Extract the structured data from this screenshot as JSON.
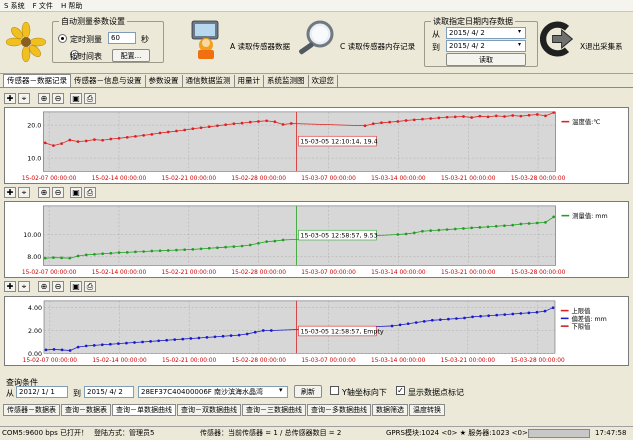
{
  "menu": [
    "S 系统",
    "F 文件",
    "H 帮助"
  ],
  "auto_measure": {
    "title": "自动测量参数设置",
    "timed_label": "定时测量",
    "interval_value": "60",
    "interval_unit": "秒",
    "by_time_label": "按时间表",
    "config_btn": "配置..."
  },
  "toolbar": {
    "read_sensor": "A 读取传感器数据",
    "read_memory": "C 读取传感器内存记录",
    "exit": "X退出采集系"
  },
  "mem_read": {
    "title": "读取指定日期内存数据",
    "from_label": "从",
    "from_date": "2015/ 4/ 2",
    "to_label": "到",
    "to_date": "2015/ 4/ 2",
    "read_btn": "读取"
  },
  "tabs": [
    "传感器－数据记录",
    "传感器－信息与设置",
    "参数设置",
    "通信数据监测",
    "用量计",
    "系统监测图",
    "欢迎您"
  ],
  "query": {
    "title": "查询条件",
    "from_label": "从",
    "from_date": "2012/ 1/ 1",
    "to_label": "到",
    "to_date": "2015/ 4/ 2",
    "sensor": "28EF37C40400006F  南沙滨海水晶湾",
    "refresh": "刷新",
    "y_down_label": "Y轴坐标向下",
    "show_points_label": "显示数据点标记"
  },
  "bottom_tabs": [
    "传感器－数据表",
    "查询－数据表",
    "查询－单数据曲线",
    "查询－双数据曲线",
    "查询－三数据曲线",
    "查询－多数据曲线",
    "数据筛选",
    "温度转换"
  ],
  "status": {
    "port": "COM5:9600 bps 已打开！",
    "login": "登陆方式：管理员5",
    "sensor_info": "传感器：当前传感器 = 1 / 总传感器数目 = 2",
    "gprs": "GPRS模块:1024 <0> ★ 服务器:1023 <0>",
    "time": "17:47:58"
  },
  "colors": {
    "temp": "#e02020",
    "measure": "#20a020",
    "upper": "#e02020",
    "bias": "#1a1acc",
    "lower": "#cc2020",
    "cursor1": "#d82020",
    "cursor2": "#20a020",
    "cursor3": "#d82020"
  },
  "chart_data": [
    {
      "type": "line",
      "x_ticks": [
        "15-02-07 00:00:00",
        "15-02-14 00:00:00",
        "15-02-21 00:00:00",
        "15-02-28 00:00:00",
        "15-03-07 00:00:00",
        "15-03-14 00:00:00",
        "15-03-21 00:00:00",
        "15-03-28 00:00:00"
      ],
      "y_ticks": [
        "10.0",
        "20.0"
      ],
      "ylim": [
        6,
        24
      ],
      "series": [
        {
          "name": "温度值:℃",
          "values": [
            14.6,
            13.8,
            14.4,
            15.5,
            15.0,
            15.2,
            15.6,
            15.4,
            15.8,
            16.0,
            16.3,
            16.6,
            16.9,
            17.2,
            17.6,
            17.9,
            18.2,
            18.5,
            18.9,
            19.2,
            19.5,
            19.8,
            20.1,
            20.4,
            20.6,
            20.9,
            21.1,
            21.3,
            21.0,
            20.2,
            20.5,
            null,
            null,
            null,
            null,
            null,
            null,
            null,
            null,
            19.8,
            20.4,
            20.7,
            20.9,
            21.1,
            21.4,
            21.6,
            21.8,
            22.0,
            22.2,
            22.4,
            22.5,
            22.6,
            22.3,
            22.7,
            22.5,
            22.8,
            22.6,
            22.9,
            22.7,
            23.0,
            23.2,
            22.8,
            23.8
          ]
        }
      ],
      "cursor_label": "15-03-05 12:10:14, 19.4"
    },
    {
      "type": "line",
      "x_ticks": [
        "15-02-07 00:00:00",
        "15-02-14 00:00:00",
        "15-02-21 00:00:00",
        "15-02-28 00:00:00",
        "15-03-07 00:00:00",
        "15-03-14 00:00:00",
        "15-03-21 00:00:00",
        "15-03-28 00:00:00"
      ],
      "y_ticks": [
        "8.00",
        "10.00"
      ],
      "ylim": [
        7.2,
        12.6
      ],
      "series": [
        {
          "name": "测量值: mm",
          "values": [
            7.85,
            7.9,
            7.88,
            7.85,
            8.05,
            8.15,
            8.2,
            8.25,
            8.3,
            8.35,
            8.38,
            8.42,
            8.45,
            8.5,
            8.52,
            8.55,
            8.58,
            8.62,
            8.65,
            8.7,
            8.75,
            8.8,
            8.85,
            8.9,
            8.95,
            9.05,
            9.2,
            9.35,
            9.4,
            9.5,
            null,
            null,
            null,
            null,
            null,
            null,
            null,
            null,
            null,
            null,
            null,
            null,
            null,
            10.0,
            10.05,
            10.15,
            10.3,
            10.35,
            10.4,
            10.45,
            10.5,
            10.55,
            10.6,
            10.65,
            10.7,
            10.75,
            10.8,
            10.85,
            10.95,
            11.0,
            11.05,
            11.1,
            11.6
          ]
        }
      ],
      "cursor_label": "15-03-05 12:58:57, 9.53"
    },
    {
      "type": "line",
      "x_ticks": [
        "15-02-07 00:00:00",
        "15-02-14 00:00:00",
        "15-02-21 00:00:00",
        "15-02-28 00:00:00",
        "15-03-07 00:00:00",
        "15-03-14 00:00:00",
        "15-03-21 00:00:00",
        "15-03-28 00:00:00"
      ],
      "y_ticks": [
        "0.00",
        "2.00",
        "4.00"
      ],
      "ylim": [
        0,
        4.6
      ],
      "series": [
        {
          "name": "上限值",
          "values": []
        },
        {
          "name": "偏差值: mm",
          "values": [
            0.3,
            0.35,
            0.3,
            0.25,
            0.55,
            0.65,
            0.7,
            0.75,
            0.8,
            0.85,
            0.9,
            0.95,
            1.0,
            1.05,
            1.1,
            1.15,
            1.2,
            1.25,
            1.3,
            1.35,
            1.4,
            1.45,
            1.5,
            1.55,
            1.6,
            1.7,
            1.85,
            2.0,
            2.0,
            null,
            null,
            null,
            null,
            null,
            null,
            null,
            null,
            null,
            null,
            null,
            null,
            null,
            null,
            2.4,
            2.5,
            2.6,
            2.7,
            2.8,
            2.9,
            2.95,
            3.0,
            3.05,
            3.1,
            3.2,
            3.25,
            3.3,
            3.35,
            3.4,
            3.45,
            3.5,
            3.55,
            3.6,
            3.7,
            4.0
          ]
        },
        {
          "name": "下限值",
          "values": []
        }
      ],
      "cursor_label": "15-03-05 12:58:57, Empty"
    }
  ]
}
